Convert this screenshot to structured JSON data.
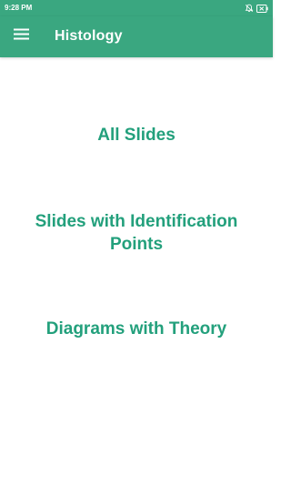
{
  "status_bar": {
    "time": "9:28 PM",
    "icons": [
      "notifications-off-icon",
      "battery-icon"
    ]
  },
  "app_bar": {
    "title": "Histology",
    "menu_icon": "hamburger-menu-icon"
  },
  "menu_options": [
    {
      "label": "All Slides"
    },
    {
      "label": "Slides with Identification Points"
    },
    {
      "label": "Diagrams with Theory"
    }
  ],
  "colors": {
    "primary": "#3aa780",
    "accent_text": "#23a07c",
    "background": "#ffffff"
  }
}
